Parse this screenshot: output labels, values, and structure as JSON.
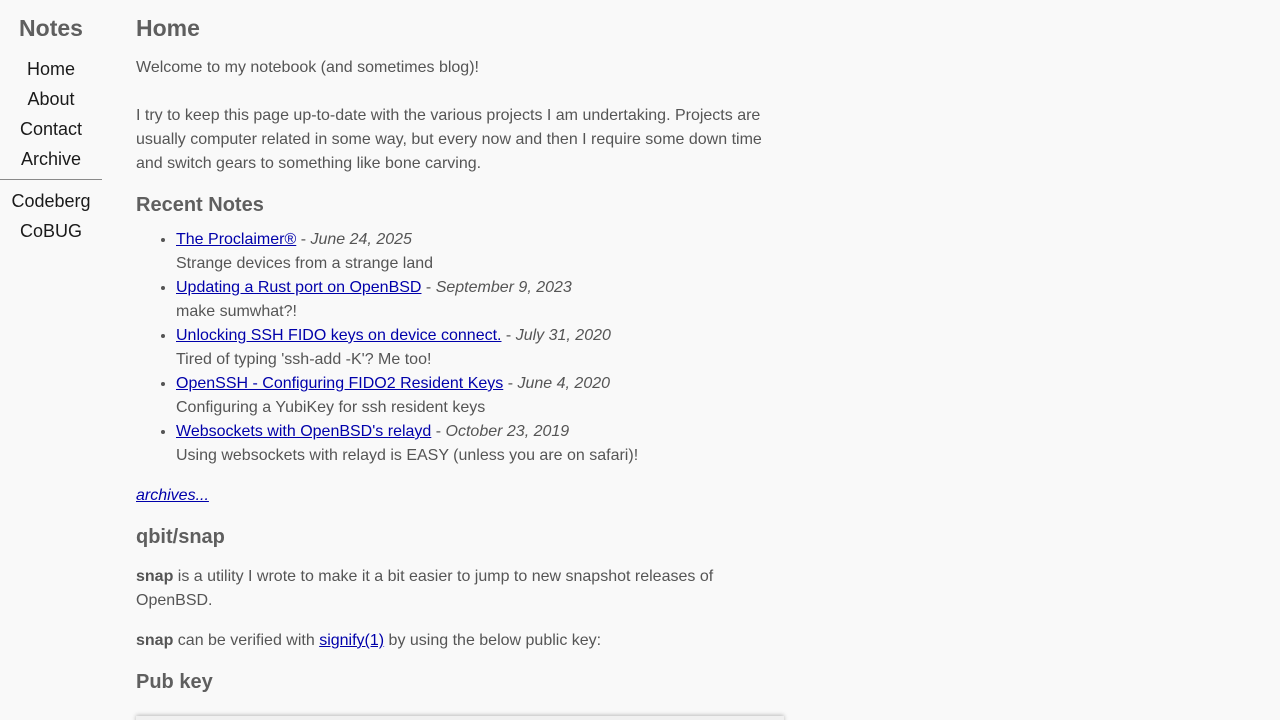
{
  "sidebar": {
    "brand": "Notes",
    "nav": [
      {
        "label": "Home"
      },
      {
        "label": "About"
      },
      {
        "label": "Contact"
      },
      {
        "label": "Archive"
      }
    ],
    "external": [
      {
        "label": "Codeberg"
      },
      {
        "label": "CoBUG"
      }
    ]
  },
  "main": {
    "title": "Home",
    "welcome": "Welcome to my notebook (and sometimes blog)!",
    "intro": "I try to keep this page up-to-date with the various projects I am undertaking. Projects are usually computer related in some way, but every now and then I require some down time and switch gears to something like bone carving.",
    "recent_title": "Recent Notes",
    "separator": " - ",
    "notes": [
      {
        "title": "The Proclaimer®",
        "date": "June 24, 2025",
        "summary": "Strange devices from a strange land"
      },
      {
        "title": "Updating a Rust port on OpenBSD",
        "date": "September 9, 2023",
        "summary": "make sumwhat?!"
      },
      {
        "title": "Unlocking SSH FIDO keys on device connect.",
        "date": "July 31, 2020",
        "summary": "Tired of typing 'ssh-add -K'? Me too!"
      },
      {
        "title": "OpenSSH - Configuring FIDO2 Resident Keys",
        "date": "June 4, 2020",
        "summary": "Configuring a YubiKey for ssh resident keys"
      },
      {
        "title": "Websockets with OpenBSD's relayd",
        "date": "October 23, 2019",
        "summary": "Using websockets with relayd is EASY (unless you are on safari)!"
      }
    ],
    "archives_link": "archives...",
    "snap": {
      "title": "qbit/snap",
      "desc_bold": "snap",
      "desc_rest": " is a utility I wrote to make it a bit easier to jump to new snapshot releases of OpenBSD.",
      "verify_bold": "snap",
      "verify_pre": " can be verified with ",
      "verify_link": "signify(1)",
      "verify_post": " by using the below public key:"
    },
    "pubkey_title": "Pub key"
  }
}
